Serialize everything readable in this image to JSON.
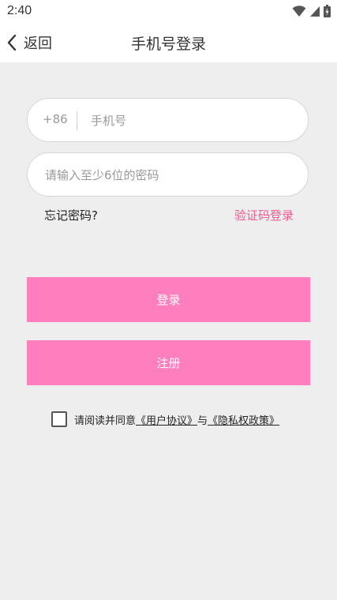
{
  "status_bar": {
    "time": "2:40",
    "icons": [
      "wifi-icon",
      "signal-icon",
      "battery-icon"
    ]
  },
  "header": {
    "back_label": "返回",
    "title": "手机号登录"
  },
  "form": {
    "country_code": "+86",
    "phone_placeholder": "手机号",
    "password_placeholder": "请输入至少6位的密码",
    "forgot_label": "忘记密码?",
    "code_login_label": "验证码登录"
  },
  "buttons": {
    "login_label": "登录",
    "register_label": "注册"
  },
  "agreement": {
    "prefix": "请阅读并同意",
    "user_agreement": "《用户协议》",
    "conjunction": "与",
    "privacy_policy": "《隐私权政策》",
    "checked": false
  },
  "colors": {
    "accent_pink": "#ff7ebd",
    "link_pink": "#ee5a93",
    "background": "#eeeeef"
  }
}
